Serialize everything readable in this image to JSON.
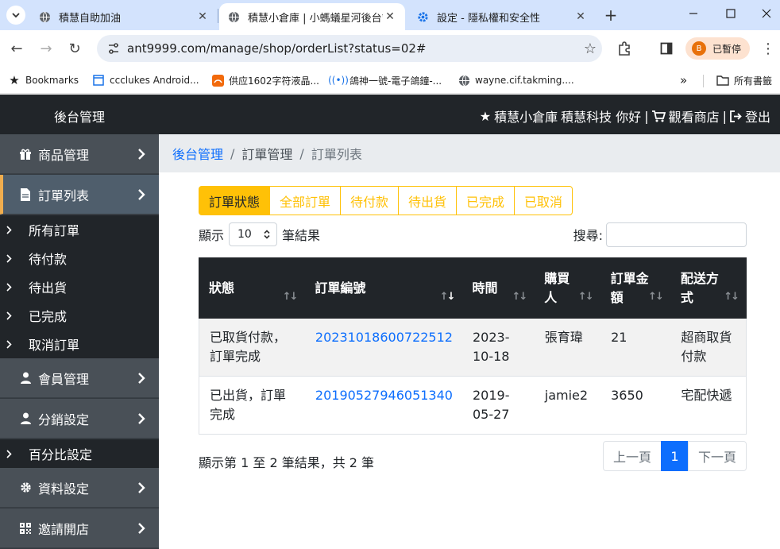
{
  "browser": {
    "tabs": [
      {
        "title": "積慧自助加油",
        "favicon": "globe-icon",
        "active": false
      },
      {
        "title": "積慧小倉庫 | 小螞蟻星河後台管",
        "favicon": "globe-icon",
        "active": true
      },
      {
        "title": "設定 - 隱私權和安全性",
        "favicon": "gear-icon",
        "active": false
      }
    ],
    "url": "ant9999.com/manage/shop/orderList?status=02#",
    "profile_initial": "B",
    "profile_label": "已暫停",
    "bookmarks": [
      {
        "label": "Bookmarks",
        "icon": "star-icon"
      },
      {
        "label": "ccclukes Android...",
        "icon": "page-icon"
      },
      {
        "label": "供应1602字符液晶...",
        "icon": "shop-icon"
      },
      {
        "label": "鴿神一號-電子鴿鐘-...",
        "icon": "signal-icon"
      },
      {
        "label": "wayne.cif.takming....",
        "icon": "globe-icon"
      }
    ],
    "all_bookmarks_label": "所有書籤"
  },
  "header": {
    "brand": "後台管理",
    "shop_name": "積慧小倉庫",
    "greeting": "積慧科技 你好",
    "view_shop": "觀看商店",
    "logout": "登出",
    "separator": "|"
  },
  "sidebar": {
    "items": [
      {
        "label": "商品管理",
        "icon": "gift-icon",
        "type": "main"
      },
      {
        "label": "訂單列表",
        "icon": "file-icon",
        "type": "main",
        "active": true
      },
      {
        "label": "所有訂單",
        "type": "sub"
      },
      {
        "label": "待付款",
        "type": "sub"
      },
      {
        "label": "待出貨",
        "type": "sub"
      },
      {
        "label": "已完成",
        "type": "sub"
      },
      {
        "label": "取消訂單",
        "type": "sub"
      },
      {
        "label": "會員管理",
        "icon": "user-icon",
        "type": "main"
      },
      {
        "label": "分銷設定",
        "icon": "user-icon",
        "type": "main"
      },
      {
        "label": "百分比設定",
        "type": "sub"
      },
      {
        "label": "資料設定",
        "icon": "gear-icon",
        "type": "main"
      },
      {
        "label": "邀請開店",
        "icon": "qrcode-icon",
        "type": "main"
      }
    ]
  },
  "breadcrumb": {
    "home": "後台管理",
    "section": "訂單管理",
    "current": "訂單列表",
    "separator": "/"
  },
  "filters": {
    "buttons": [
      "訂單狀態",
      "全部訂單",
      "待付款",
      "待出貨",
      "已完成",
      "已取消"
    ]
  },
  "table_controls": {
    "show_label": "顯示",
    "page_length": "10",
    "entries_label": "筆結果",
    "search_label": "搜尋:",
    "search_value": ""
  },
  "table": {
    "columns": [
      {
        "line1": "狀態",
        "line2": ""
      },
      {
        "line1": "訂單編號",
        "line2": ""
      },
      {
        "line1": "時間",
        "line2": ""
      },
      {
        "line1": "購買",
        "line2": "人"
      },
      {
        "line1": "訂單金",
        "line2": "額"
      },
      {
        "line1": "配送方",
        "line2": "式"
      }
    ],
    "rows": [
      {
        "status": "已取貨付款，訂單完成",
        "order_no": "20231018600722512",
        "time": "2023-10-18",
        "buyer": "張育瑋",
        "amount": "21",
        "shipping": "超商取貨付款"
      },
      {
        "status": "已出貨，訂單完成",
        "order_no": "20190527946051340",
        "time": "2019-05-27",
        "buyer": "jamie2",
        "amount": "3650",
        "shipping": "宅配快遞"
      }
    ]
  },
  "footer": {
    "info": "顯示第 1 至 2 筆結果，共 2 筆",
    "prev": "上一頁",
    "current_page": "1",
    "next": "下一頁"
  }
}
